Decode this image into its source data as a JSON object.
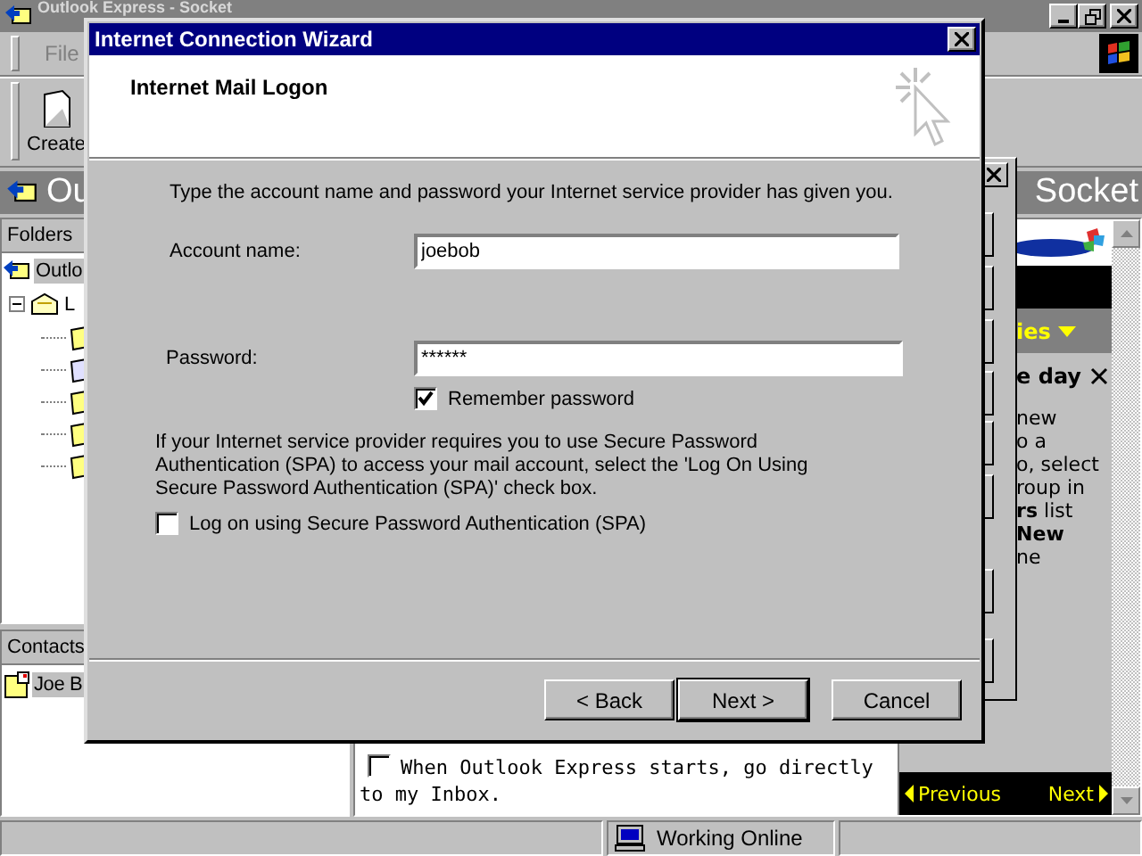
{
  "main_window": {
    "title": "Outlook Express - Socket",
    "menu": [
      "File"
    ],
    "toolbar": [
      {
        "label": "Create"
      }
    ],
    "header": {
      "title": "Ou",
      "location": "Socket"
    },
    "folders_pane": {
      "title": "Folders",
      "tree": [
        {
          "label": "Outlo",
          "selected": true,
          "children": [
            {
              "label": "L",
              "expanded": true
            }
          ]
        }
      ]
    },
    "contacts_pane": {
      "title": "Contacts",
      "items": [
        {
          "label": "Joe B",
          "selected": true
        }
      ]
    },
    "start_page": {
      "inbox_option": {
        "label": "When Outlook Express starts, go directly to my Inbox.",
        "checked": false
      },
      "msn_panel": {
        "section": "ies",
        "tip_title": "e day",
        "tip_lines": [
          "new",
          "o a",
          "o, select",
          "roup in",
          "**rs** list",
          "**New**",
          "ne"
        ],
        "nav": [
          "Previous",
          "Next"
        ]
      }
    },
    "status_bar": {
      "connection": "Working Online"
    }
  },
  "wizard": {
    "title": "Internet Connection Wizard",
    "heading": "Internet Mail Logon",
    "intro": "Type the account name and password your Internet service provider has given you.",
    "account_name": {
      "label": "Account name:",
      "value": "joebob"
    },
    "password": {
      "label": "Password:",
      "value": "******"
    },
    "remember_password": {
      "label": "Remember password",
      "checked": true
    },
    "spa_note": "If your Internet service provider requires you to use Secure Password Authentication (SPA) to access your mail account, select the 'Log On Using Secure Password Authentication (SPA)' check box.",
    "spa": {
      "label": "Log on using Secure Password Authentication (SPA)",
      "checked": false
    },
    "buttons": [
      {
        "label": "< Back",
        "default": false
      },
      {
        "label": "Next >",
        "default": true
      },
      {
        "label": "Cancel",
        "default": false
      }
    ]
  }
}
